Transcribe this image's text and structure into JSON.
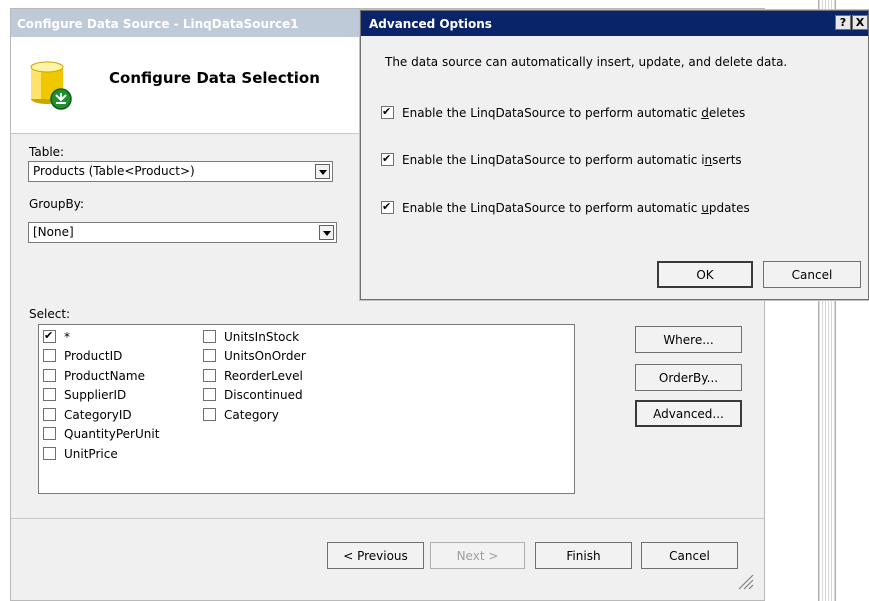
{
  "main_dialog": {
    "title": "Configure Data Source - LinqDataSource1",
    "header_title": "Configure Data Selection",
    "table_label": "Table:",
    "table_value": "Products (Table<Product>)",
    "groupby_label": "GroupBy:",
    "groupby_value": "[None]",
    "select_label": "Select:",
    "columns": [
      {
        "label": "*",
        "checked": true
      },
      {
        "label": "ProductID",
        "checked": false
      },
      {
        "label": "ProductName",
        "checked": false
      },
      {
        "label": "SupplierID",
        "checked": false
      },
      {
        "label": "CategoryID",
        "checked": false
      },
      {
        "label": "QuantityPerUnit",
        "checked": false
      },
      {
        "label": "UnitPrice",
        "checked": false
      },
      {
        "label": "UnitsInStock",
        "checked": false
      },
      {
        "label": "UnitsOnOrder",
        "checked": false
      },
      {
        "label": "ReorderLevel",
        "checked": false
      },
      {
        "label": "Discontinued",
        "checked": false
      },
      {
        "label": "Category",
        "checked": false
      }
    ],
    "side_buttons": {
      "where": "Where...",
      "orderby": "OrderBy...",
      "advanced": "Advanced..."
    },
    "footer_buttons": {
      "previous": "< Previous",
      "next": "Next >",
      "finish": "Finish",
      "cancel": "Cancel"
    }
  },
  "advanced_dialog": {
    "title": "Advanced Options",
    "help_label": "?",
    "close_label": "X",
    "description": "The data source can automatically insert, update, and delete data.",
    "options": [
      {
        "prefix": "Enable the LinqDataSource to perform automatic ",
        "accel": "d",
        "suffix": "eletes",
        "checked": true
      },
      {
        "prefix": "Enable the LinqDataSource to perform automatic i",
        "accel": "n",
        "suffix": "serts",
        "checked": true
      },
      {
        "prefix": "Enable the LinqDataSource to perform automatic ",
        "accel": "u",
        "suffix": "pdates",
        "checked": true
      }
    ],
    "ok_label": "OK",
    "cancel_label": "Cancel"
  }
}
